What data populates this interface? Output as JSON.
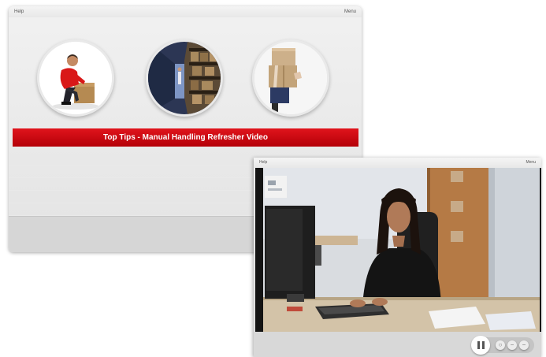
{
  "back_window": {
    "help_label": "Help",
    "menu_label": "Menu",
    "banner_title": "Top Tips - Manual Handling Refresher Video",
    "thumbnails": [
      "worker-lifting-box-photo",
      "warehouse-shelves-photo",
      "carrying-boxes-photo"
    ]
  },
  "front_window": {
    "help_label": "Help",
    "menu_label": "Menu",
    "video": "woman-typing-at-desk-video-frame",
    "controls": {
      "play_state": "paused",
      "icons": [
        "pause-icon",
        "replay-icon",
        "volume-down-icon",
        "volume-up-icon"
      ]
    }
  },
  "colors": {
    "banner_red": "#d0101a",
    "window_gray": "#e6e6e6"
  }
}
